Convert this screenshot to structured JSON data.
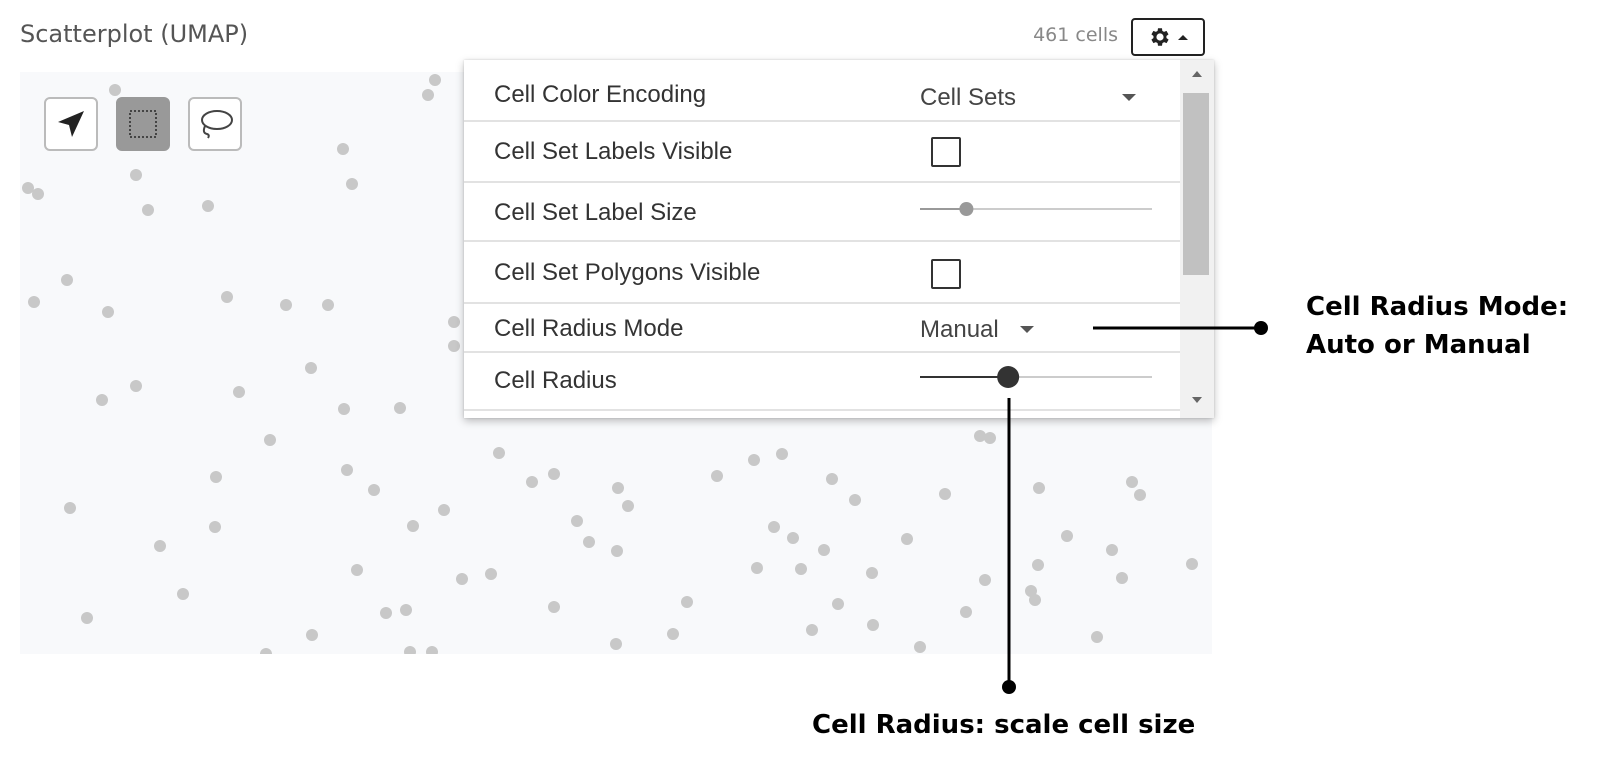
{
  "title": "Scatterplot (UMAP)",
  "cell_count": "461 cells",
  "tools": [
    {
      "name": "pan-tool",
      "icon": "navigate-arrow-icon",
      "active": false
    },
    {
      "name": "rectangle-select-tool",
      "icon": "dotted-rectangle-icon",
      "active": true
    },
    {
      "name": "lasso-select-tool",
      "icon": "lasso-icon",
      "active": false
    }
  ],
  "settings": {
    "rows": [
      {
        "label": "Cell Color Encoding",
        "type": "select",
        "value": "Cell Sets"
      },
      {
        "label": "Cell Set Labels Visible",
        "type": "checkbox",
        "checked": false
      },
      {
        "label": "Cell Set Label Size",
        "type": "slider",
        "value": 0.2
      },
      {
        "label": "Cell Set Polygons Visible",
        "type": "checkbox",
        "checked": false
      },
      {
        "label": "Cell Radius Mode",
        "type": "select",
        "value": "Manual"
      },
      {
        "label": "Cell Radius",
        "type": "slider",
        "value": 0.38
      }
    ]
  },
  "annotations": {
    "radius_mode_line1": "Cell Radius Mode:",
    "radius_mode_line2": "Auto or Manual",
    "radius": "Cell Radius: scale cell size"
  },
  "colors": {
    "cell_dot": "#c8c8c8",
    "plot_background": "#f8f9fb",
    "annotation_line": "#000000"
  }
}
